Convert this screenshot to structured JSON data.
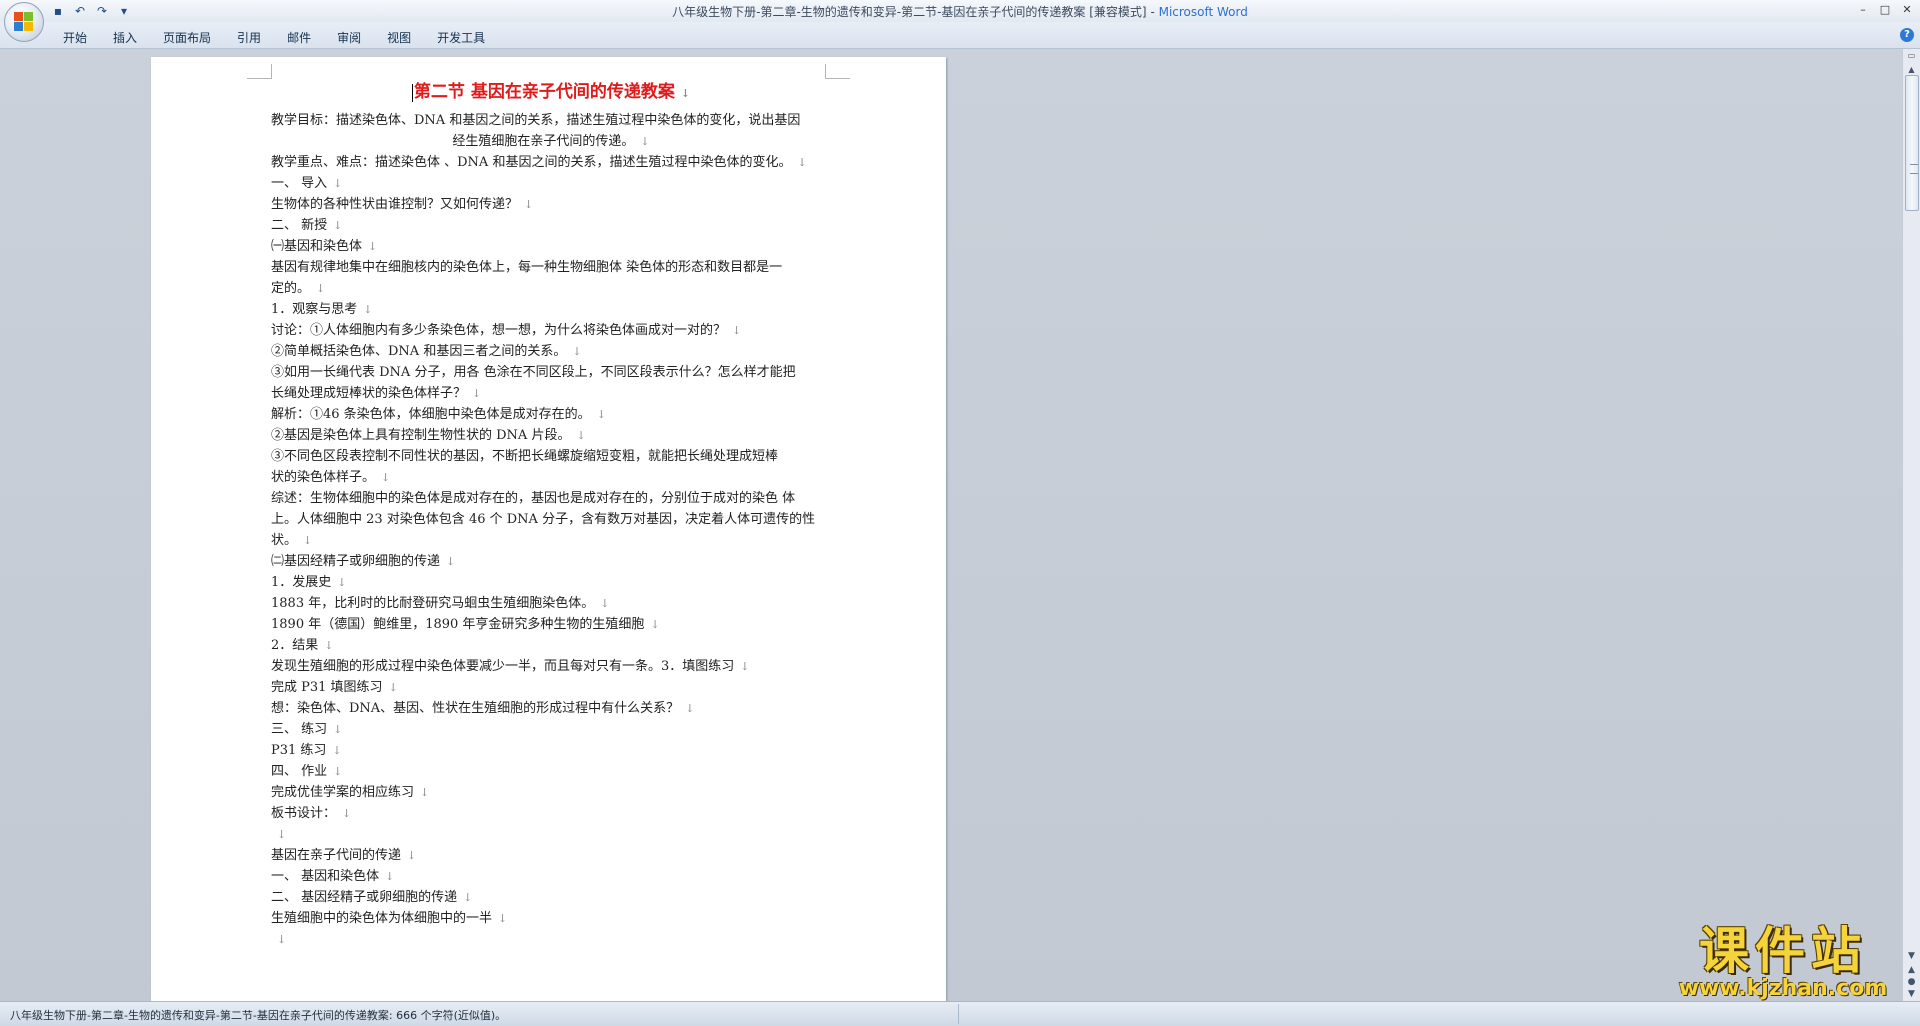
{
  "titlebar": {
    "title": "八年级生物下册-第二章-生物的遗传和变异-第二节-基因在亲子代间的传递教案 [兼容模式]",
    "separator": " - ",
    "app_name": "Microsoft Word",
    "qat_customize": "▾"
  },
  "ribbon": {
    "tabs": [
      "开始",
      "插入",
      "页面布局",
      "引用",
      "邮件",
      "审阅",
      "视图",
      "开发工具"
    ]
  },
  "document": {
    "title": "第二节  基因在亲子代间的传递教案",
    "lines": [
      {
        "text": "教学目标：描述染色体、DNA 和基因之间的关系，描述生殖过程中染色体的变化，说出基因",
        "center": false,
        "mark": false
      },
      {
        "text": "经生殖细胞在亲子代间的传递。",
        "center": true,
        "mark": true
      },
      {
        "text": "教学重点、难点：描述染色体 、DNA 和基因之间的关系，描述生殖过程中染色体的变化。",
        "center": false,
        "mark": true
      },
      {
        "text": "一、  导入",
        "center": false,
        "mark": true
      },
      {
        "text": "生物体的各种性状由谁控制？又如何传递？",
        "center": false,
        "mark": true
      },
      {
        "text": "二、  新授",
        "center": false,
        "mark": true
      },
      {
        "text": "㈠基因和染色体",
        "center": false,
        "mark": true
      },
      {
        "text": "基因有规律地集中在细胞核内的染色体上，每一种生物细胞体 染色体的形态和数目都是一",
        "center": false,
        "mark": false
      },
      {
        "text": "定的。",
        "center": false,
        "mark": true
      },
      {
        "text": "1．观察与思考",
        "center": false,
        "mark": true
      },
      {
        "text": "讨论：①人体细胞内有多少条染色体，想一想，为什么将染色体画成对一对的？",
        "center": false,
        "mark": true
      },
      {
        "text": "②简单概括染色体、DNA 和基因三者之间的关系。",
        "center": false,
        "mark": true
      },
      {
        "text": "③如用一长绳代表 DNA 分子，用各 色涂在不同区段上，不同区段表示什么？怎么样才能把",
        "center": false,
        "mark": false
      },
      {
        "text": "长绳处理成短棒状的染色体样子？",
        "center": false,
        "mark": true
      },
      {
        "text": "解析：①46 条染色体，体细胞中染色体是成对存在的。",
        "center": false,
        "mark": true
      },
      {
        "text": "②基因是染色体上具有控制生物性状的 DNA 片段。",
        "center": false,
        "mark": true
      },
      {
        "text": "③不同色区段表控制不同性状的基因，不断把长绳螺旋缩短变粗，就能把长绳处理成短棒",
        "center": false,
        "mark": false
      },
      {
        "text": "状的染色体样子。",
        "center": false,
        "mark": true
      },
      {
        "text": "综述：生物体细胞中的染色体是成对存在的，基因也是成对存在的，分别位于成对的染色 体",
        "center": false,
        "mark": false
      },
      {
        "text": "上。人体细胞中 23 对染色体包含 46 个 DNA 分子，含有数万对基因，决定着人体可遗传的性",
        "center": false,
        "mark": false
      },
      {
        "text": "状。",
        "center": false,
        "mark": true
      },
      {
        "text": "㈡基因经精子或卵细胞的传递",
        "center": false,
        "mark": true
      },
      {
        "text": "1．发展史",
        "center": false,
        "mark": true
      },
      {
        "text": "1883 年，比利时的比耐登研究马蛔虫生殖细胞染色体。",
        "center": false,
        "mark": true
      },
      {
        "text": "1890 年（德国）鲍维里，1890 年亨金研究多种生物的生殖细胞",
        "center": false,
        "mark": true
      },
      {
        "text": "2．结果",
        "center": false,
        "mark": true
      },
      {
        "text": "发现生殖细胞的形成过程中染色体要减少一半，而且每对只有一条。3．填图练习",
        "center": false,
        "mark": true
      },
      {
        "text": "完成 P31 填图练习",
        "center": false,
        "mark": true
      },
      {
        "text": "想：染色体、DNA、基因、性状在生殖细胞的形成过程中有什么关系？",
        "center": false,
        "mark": true
      },
      {
        "text": "三、  练习",
        "center": false,
        "mark": true
      },
      {
        "text": "P31 练习",
        "center": false,
        "mark": true
      },
      {
        "text": "四、  作业",
        "center": false,
        "mark": true
      },
      {
        "text": "完成优佳学案的相应练习",
        "center": false,
        "mark": true
      },
      {
        "text": "板书设计：",
        "center": false,
        "mark": true
      },
      {
        "text": "",
        "center": false,
        "mark": true
      },
      {
        "text": "基因在亲子代间的传递",
        "center": false,
        "mark": true
      },
      {
        "text": "一、   基因和染色体",
        "center": false,
        "mark": true
      },
      {
        "text": "二、  基因经精子或卵细胞的传递",
        "center": false,
        "mark": true
      },
      {
        "text": "生殖细胞中的染色体为体细胞中的一半",
        "center": false,
        "mark": true
      },
      {
        "text": "",
        "center": false,
        "mark": true
      }
    ],
    "paragraph_mark": "↓"
  },
  "statusbar": {
    "text": "八年级生物下册-第二章-生物的遗传和变异-第二节-基因在亲子代间的传递教案: 666 个字符(近似值)。"
  },
  "watermark": {
    "cn": "课件站",
    "url": "www.kjzhan.com"
  }
}
